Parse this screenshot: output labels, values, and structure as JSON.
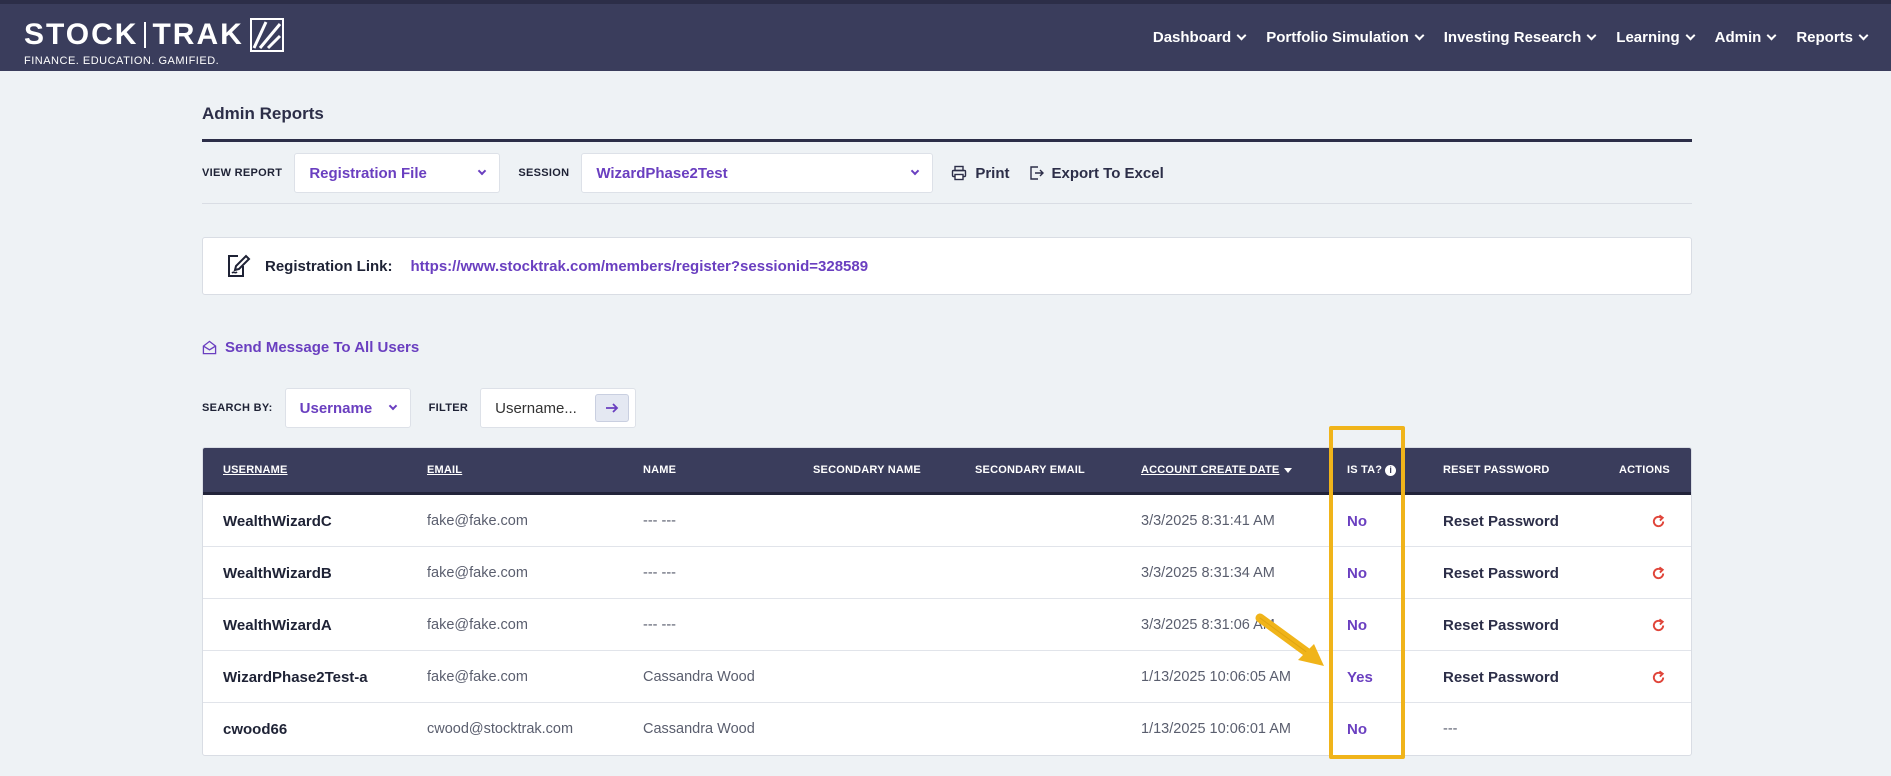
{
  "header": {
    "logo_left": "STOCK",
    "logo_right": "TRAK",
    "tagline": "FINANCE. EDUCATION. GAMIFIED.",
    "nav": [
      {
        "label": "Dashboard"
      },
      {
        "label": "Portfolio Simulation"
      },
      {
        "label": "Investing Research"
      },
      {
        "label": "Learning"
      },
      {
        "label": "Admin"
      },
      {
        "label": "Reports"
      }
    ]
  },
  "page": {
    "title": "Admin Reports",
    "view_report_label": "VIEW REPORT",
    "view_report_value": "Registration File",
    "session_label": "SESSION",
    "session_value": "WizardPhase2Test",
    "print_label": "Print",
    "export_label": "Export To Excel",
    "reglink_label": "Registration Link:",
    "reglink_url": "https://www.stocktrak.com/members/register?sessionid=328589",
    "send_message": "Send Message To All Users",
    "search_by_label": "SEARCH BY:",
    "search_by_value": "Username",
    "filter_label": "FILTER",
    "filter_placeholder": "Username..."
  },
  "table": {
    "headers": {
      "username": "USERNAME",
      "email": "EMAIL",
      "name": "NAME",
      "secondary_name": "SECONDARY NAME",
      "secondary_email": "SECONDARY EMAIL",
      "create_date": "ACCOUNT CREATE DATE",
      "is_ta": "IS TA?",
      "reset_password": "RESET PASSWORD",
      "actions": "ACTIONS"
    },
    "rows": [
      {
        "username": "WealthWizardC",
        "email": "fake@fake.com",
        "name": "--- ---",
        "secondary_name": "",
        "secondary_email": "",
        "create_date": "3/3/2025 8:31:41 AM",
        "is_ta": "No",
        "reset": "Reset Password"
      },
      {
        "username": "WealthWizardB",
        "email": "fake@fake.com",
        "name": "--- ---",
        "secondary_name": "",
        "secondary_email": "",
        "create_date": "3/3/2025 8:31:34 AM",
        "is_ta": "No",
        "reset": "Reset Password"
      },
      {
        "username": "WealthWizardA",
        "email": "fake@fake.com",
        "name": "--- ---",
        "secondary_name": "",
        "secondary_email": "",
        "create_date": "3/3/2025 8:31:06 AM",
        "is_ta": "No",
        "reset": "Reset Password"
      },
      {
        "username": "WizardPhase2Test-a",
        "email": "fake@fake.com",
        "name": "Cassandra Wood",
        "secondary_name": "",
        "secondary_email": "",
        "create_date": "1/13/2025 10:06:05 AM",
        "is_ta": "Yes",
        "reset": "Reset Password"
      },
      {
        "username": "cwood66",
        "email": "cwood@stocktrak.com",
        "name": "Cassandra Wood",
        "secondary_name": "",
        "secondary_email": "",
        "create_date": "1/13/2025 10:06:01 AM",
        "is_ta": "No",
        "reset": "---"
      }
    ]
  },
  "colors": {
    "header_bg": "#3a3d5c",
    "accent_purple": "#6a3fc0",
    "action_red": "#e0453a",
    "annotation_yellow": "#f0b41a"
  },
  "icons": {
    "print": "printer-icon",
    "export": "export-icon",
    "reglink": "edit-document-icon",
    "send": "envelope-open-icon",
    "go": "arrow-right-icon",
    "action": "refresh-icon",
    "info": "info-icon"
  }
}
